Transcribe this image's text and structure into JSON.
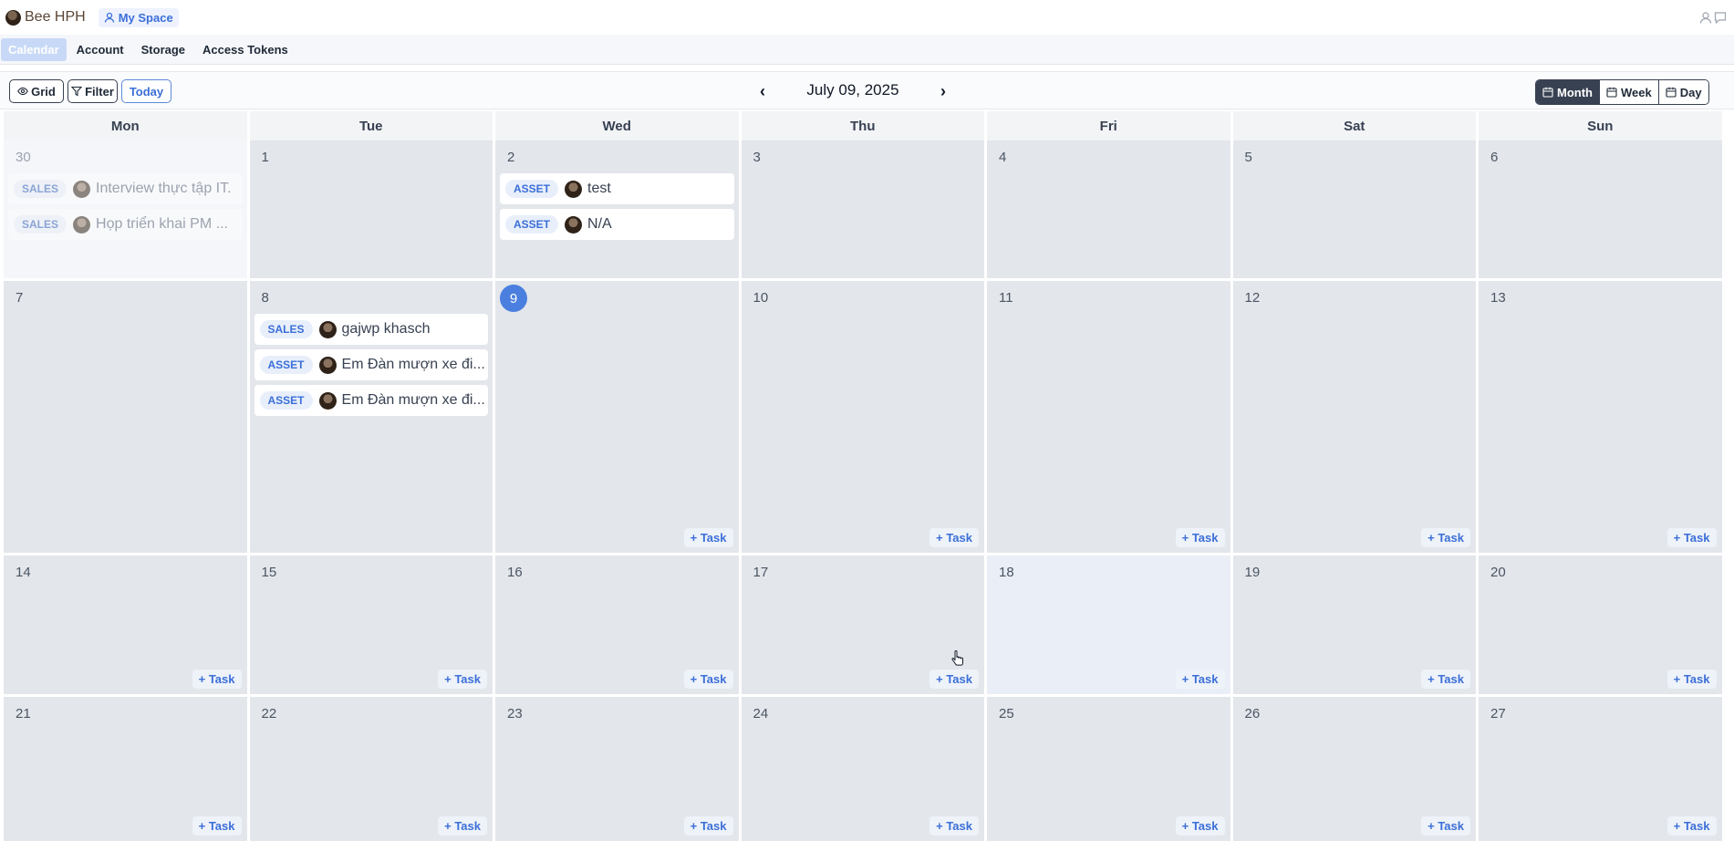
{
  "topbar": {
    "brand_name": "Bee HPH",
    "my_space_label": "My Space"
  },
  "nav": {
    "items": [
      "Calendar",
      "Account",
      "Storage",
      "Access Tokens"
    ],
    "active": "Calendar"
  },
  "toolbar": {
    "grid_label": "Grid",
    "filter_label": "Filter",
    "today_label": "Today",
    "prev_label": "‹",
    "next_label": "›",
    "date_title": "July 09, 2025",
    "views": [
      {
        "label": "Month",
        "active": true
      },
      {
        "label": "Week",
        "active": false
      },
      {
        "label": "Day",
        "active": false
      }
    ]
  },
  "calendar": {
    "weekdays": [
      "Mon",
      "Tue",
      "Wed",
      "Thu",
      "Fri",
      "Sat",
      "Sun"
    ],
    "add_task_label": "+ Task",
    "today": "9",
    "weeks": [
      [
        {
          "day": "30",
          "other_month": true,
          "events": [
            {
              "tag": "SALES",
              "title": "Interview thực tập IT."
            },
            {
              "tag": "SALES",
              "title": "Họp triển khai PM ..."
            }
          ]
        },
        {
          "day": "1",
          "events": []
        },
        {
          "day": "2",
          "events": [
            {
              "tag": "ASSET",
              "title": "test"
            },
            {
              "tag": "ASSET",
              "title": "N/A"
            }
          ]
        },
        {
          "day": "3",
          "events": []
        },
        {
          "day": "4",
          "events": []
        },
        {
          "day": "5",
          "events": []
        },
        {
          "day": "6",
          "events": []
        }
      ],
      [
        {
          "day": "7",
          "events": []
        },
        {
          "day": "8",
          "events": [
            {
              "tag": "SALES",
              "title": "gajwp khasch"
            },
            {
              "tag": "ASSET",
              "title": "Em Đàn mượn xe đi..."
            },
            {
              "tag": "ASSET",
              "title": "Em Đàn mượn xe đi..."
            }
          ]
        },
        {
          "day": "9",
          "today": true,
          "add_task": true,
          "events": []
        },
        {
          "day": "10",
          "add_task": true,
          "events": []
        },
        {
          "day": "11",
          "add_task": true,
          "events": []
        },
        {
          "day": "12",
          "add_task": true,
          "events": []
        },
        {
          "day": "13",
          "add_task": true,
          "events": []
        }
      ],
      [
        {
          "day": "14",
          "add_task": true,
          "events": []
        },
        {
          "day": "15",
          "add_task": true,
          "events": []
        },
        {
          "day": "16",
          "add_task": true,
          "events": []
        },
        {
          "day": "17",
          "add_task": true,
          "events": []
        },
        {
          "day": "18",
          "add_task": true,
          "hover": true,
          "events": []
        },
        {
          "day": "19",
          "add_task": true,
          "events": []
        },
        {
          "day": "20",
          "add_task": true,
          "events": []
        }
      ],
      [
        {
          "day": "21",
          "add_task": true,
          "events": []
        },
        {
          "day": "22",
          "add_task": true,
          "events": []
        },
        {
          "day": "23",
          "add_task": true,
          "events": []
        },
        {
          "day": "24",
          "add_task": true,
          "events": []
        },
        {
          "day": "25",
          "add_task": true,
          "events": []
        },
        {
          "day": "26",
          "add_task": true,
          "events": []
        },
        {
          "day": "27",
          "add_task": true,
          "events": []
        }
      ]
    ]
  },
  "colors": {
    "accent": "#3b6fd8",
    "today_badge": "#4a7fe0",
    "cell_bg": "#e3e6eb",
    "dark_button": "#374151"
  },
  "icons": [
    "avatar",
    "user-icon",
    "eye-icon",
    "filter-icon",
    "calendar-icon",
    "chat-icon",
    "pointer-cursor-icon"
  ]
}
